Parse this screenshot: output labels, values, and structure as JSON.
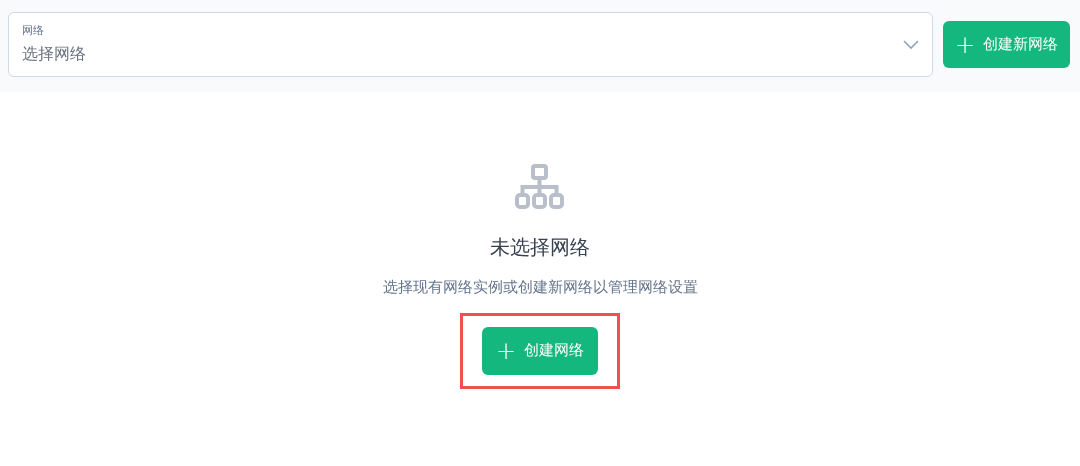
{
  "network_select": {
    "label": "网络",
    "placeholder": "选择网络"
  },
  "create_new_button": {
    "icon": "+",
    "label": "创建新网络"
  },
  "empty_state": {
    "title": "未选择网络",
    "description": "选择现有网络实例或创建新网络以管理网络设置",
    "button": {
      "icon": "+",
      "label": "创建网络",
      "highlighted": true
    }
  }
}
